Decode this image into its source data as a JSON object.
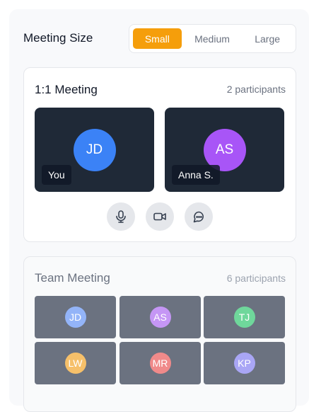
{
  "meeting_size": {
    "label": "Meeting Size",
    "options": [
      {
        "label": "Small",
        "selected": true
      },
      {
        "label": "Medium",
        "selected": false
      },
      {
        "label": "Large",
        "selected": false
      }
    ],
    "accent_color": "#f59e0b"
  },
  "one_on_one": {
    "title": "1:1 Meeting",
    "count": "2 participants",
    "participants": [
      {
        "initials": "JD",
        "name": "You",
        "color": "#3b82f6"
      },
      {
        "initials": "AS",
        "name": "Anna S.",
        "color": "#a855f7"
      }
    ],
    "controls": [
      {
        "icon": "microphone-icon"
      },
      {
        "icon": "video-camera-icon"
      },
      {
        "icon": "chat-bubble-icon"
      }
    ]
  },
  "team": {
    "title": "Team Meeting",
    "count": "6 participants",
    "participants": [
      {
        "initials": "JD",
        "color": "#93b4f8"
      },
      {
        "initials": "AS",
        "color": "#c596f5"
      },
      {
        "initials": "TJ",
        "color": "#6fd79b"
      },
      {
        "initials": "LW",
        "color": "#f6c06a"
      },
      {
        "initials": "MR",
        "color": "#f08a8a"
      },
      {
        "initials": "KP",
        "color": "#a9a6f5"
      }
    ]
  }
}
